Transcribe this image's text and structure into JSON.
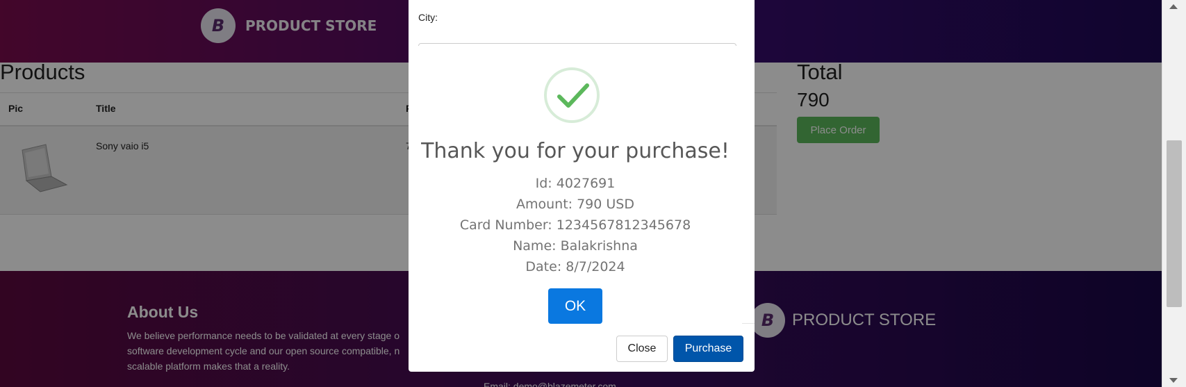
{
  "header": {
    "brand_logo_letter": "B",
    "brand_name": "PRODUCT STORE"
  },
  "cart": {
    "title": "Products",
    "columns": [
      "Pic",
      "Title",
      "P"
    ],
    "rows": [
      {
        "title": "Sony vaio i5",
        "price_partial": "7"
      }
    ],
    "total_label": "Total",
    "total_value": "790",
    "place_order_label": "Place Order"
  },
  "footer": {
    "about_title": "About Us",
    "about_text": "We believe performance needs to be validated at every stage o software development cycle and our open source compatible, n scalable platform makes that a reality.",
    "email": "Email: demo@blazemeter.com",
    "brand_logo_letter": "B",
    "brand_name": "PRODUCT STORE"
  },
  "order_modal": {
    "city_label": "City:",
    "close_label": "Close",
    "purchase_label": "Purchase"
  },
  "alert": {
    "title": "Thank you for your purchase!",
    "lines": [
      "Id: 4027691",
      "Amount: 790 USD",
      "Card Number: 1234567812345678",
      "Name: Balakrishna",
      "Date: 8/7/2024"
    ],
    "ok_label": "OK",
    "icon": "check-icon",
    "accent_color": "#5cb85c"
  }
}
